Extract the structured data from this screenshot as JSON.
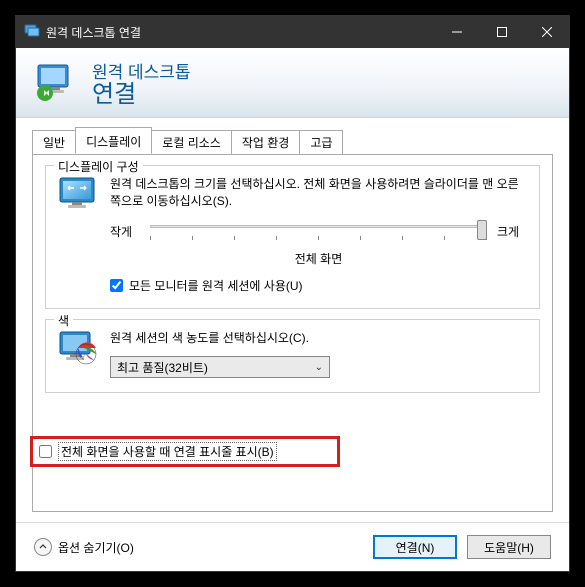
{
  "titlebar": {
    "title": "원격 데스크톱 연결"
  },
  "header": {
    "line1": "원격 데스크톱",
    "line2": "연결"
  },
  "tabs": {
    "general": "일반",
    "display": "디스플레이",
    "local": "로컬 리소스",
    "experience": "작업 환경",
    "advanced": "고급"
  },
  "display_config": {
    "legend": "디스플레이 구성",
    "desc": "원격 데스크톱의 크기를 선택하십시오. 전체 화면을 사용하려면 슬라이더를 맨 오른쪽으로 이동하십시오(S).",
    "small": "작게",
    "large": "크게",
    "value": "전체 화면",
    "all_monitors": "모든 모니터를 원격 세션에 사용(U)"
  },
  "color": {
    "legend": "색",
    "desc": "원격 세션의 색 농도를 선택하십시오(C).",
    "combo_value": "최고 품질(32비트)"
  },
  "connection_bar": {
    "label": "전체 화면을 사용할 때 연결 표시줄 표시(B)"
  },
  "footer": {
    "options": "옵션 숨기기(O)",
    "connect": "연결(N)",
    "help": "도움말(H)"
  }
}
